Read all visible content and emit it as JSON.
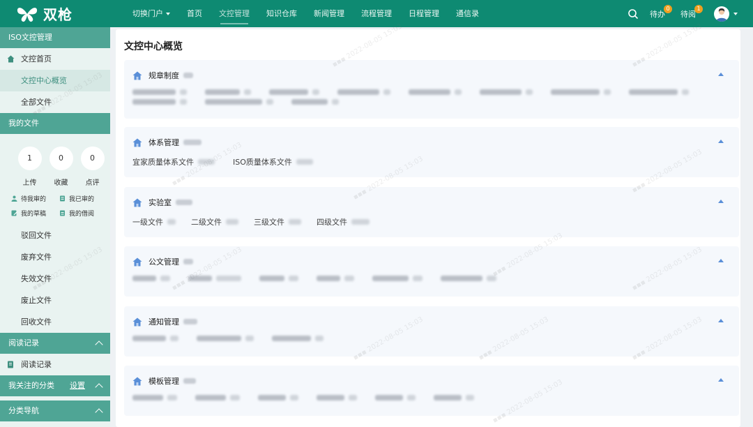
{
  "app": {
    "logo_text": "双枪",
    "brand_color": "#0e8a72"
  },
  "topnav": {
    "switch_portal": "切换门户",
    "items": [
      "首页",
      "文控管理",
      "知识仓库",
      "新闻管理",
      "流程管理",
      "日程管理",
      "通信录"
    ],
    "active": "文控管理",
    "todo_label": "待办",
    "todo_count": "0",
    "toread_label": "待阅",
    "toread_count": "1"
  },
  "sidebar": {
    "section1_title": "ISO文控管理",
    "home_item": "文控首页",
    "overview_item": "文控中心概览",
    "all_files_item": "全部文件",
    "section2_title": "我的文件",
    "counters": [
      {
        "value": "1",
        "label": "上传"
      },
      {
        "value": "0",
        "label": "收藏"
      },
      {
        "value": "0",
        "label": "点评"
      }
    ],
    "quick": [
      "待我审的",
      "我已审的",
      "我的草稿",
      "我的借阅"
    ],
    "file_items": [
      "驳回文件",
      "废弃文件",
      "失效文件",
      "废止文件",
      "回收文件"
    ],
    "section3_title": "阅读记录",
    "read_item": "阅读记录",
    "section4_title": "我关注的分类",
    "section4_link": "设置",
    "section5_title": "分类导航"
  },
  "main": {
    "title": "文控中心概览",
    "cards": [
      {
        "title": "规章制度",
        "items": []
      },
      {
        "title": "体系管理",
        "items": [
          "宜家质量体系文件",
          "ISO质量体系文件"
        ]
      },
      {
        "title": "实验室",
        "items": [
          "一级文件",
          "二级文件",
          "三级文件",
          "四级文件"
        ]
      },
      {
        "title": "公文管理",
        "items": []
      },
      {
        "title": "通知管理",
        "items": []
      },
      {
        "title": "模板管理",
        "items": []
      }
    ]
  }
}
